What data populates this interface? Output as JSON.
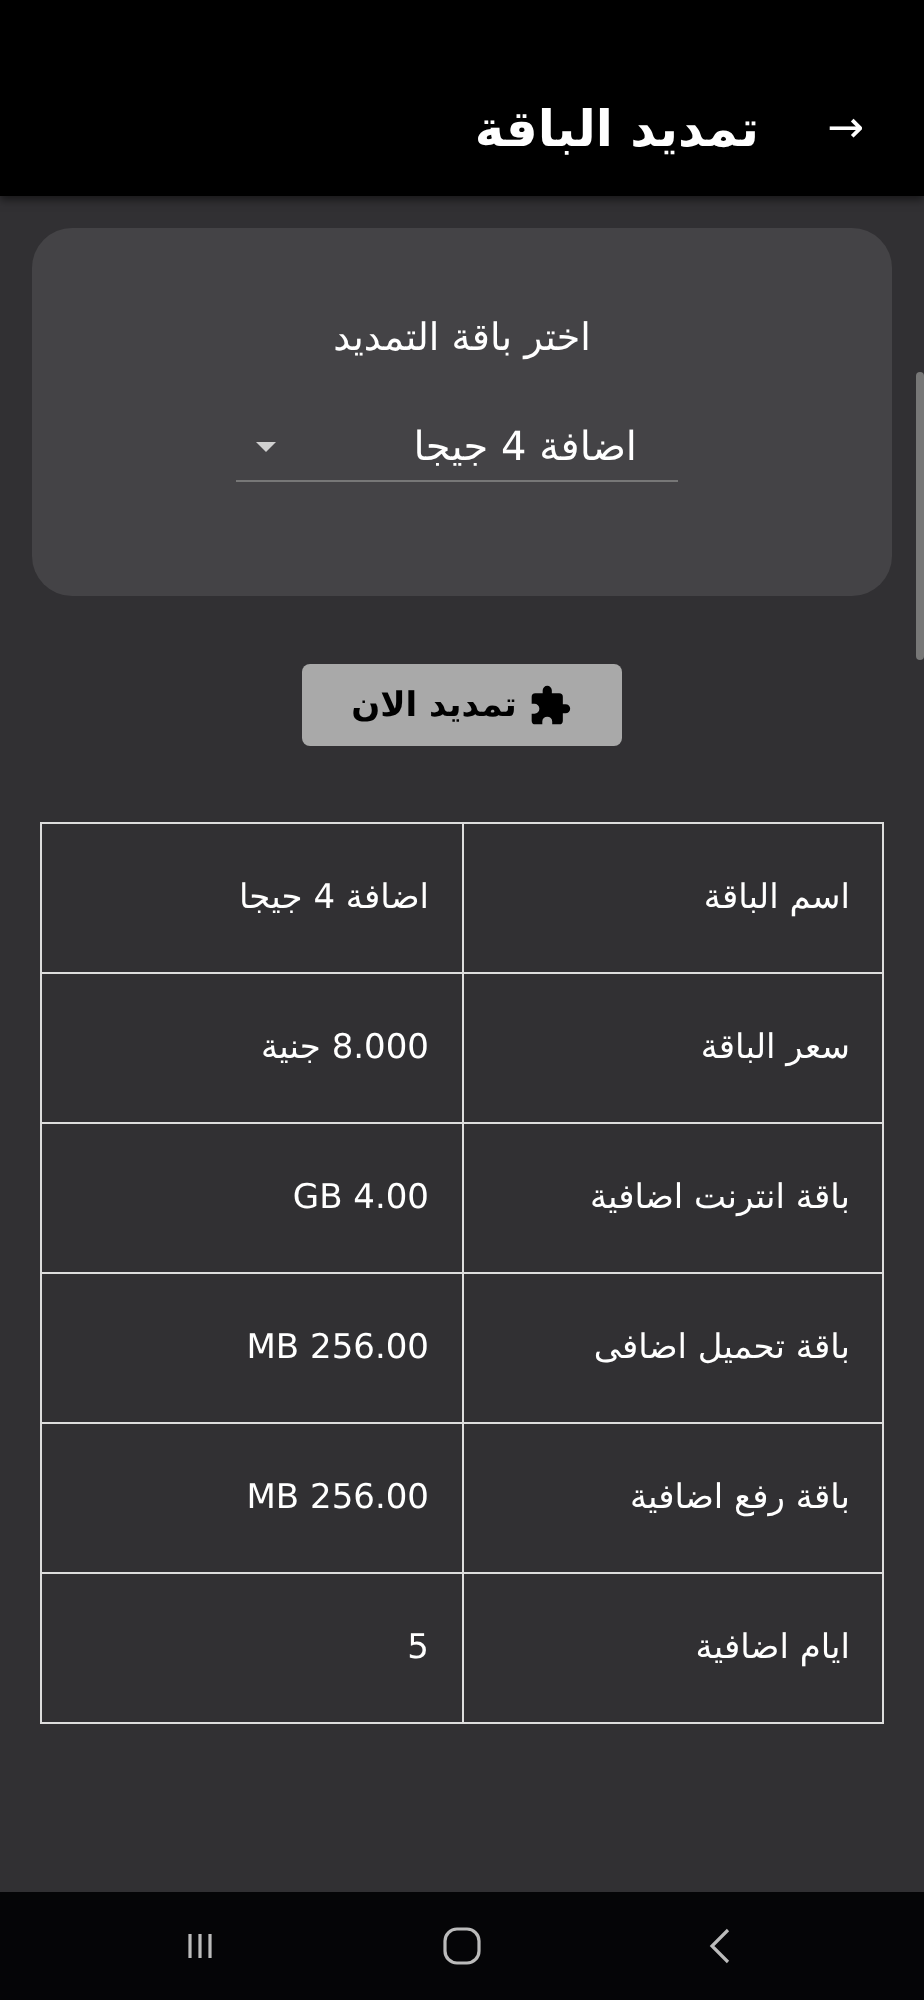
{
  "app_bar": {
    "title": "تمديد الباقة",
    "back": "→"
  },
  "card": {
    "label": "اختر باقة التمديد",
    "dropdown": {
      "value": "اضافة 4 جيجا"
    }
  },
  "renew_button": {
    "label": "تمديد الان"
  },
  "details": [
    {
      "label": "اسم الباقة",
      "value": "اضافة 4 جيجا"
    },
    {
      "label": "سعر الباقة",
      "value": "8.000 جنية"
    },
    {
      "label": "باقة انترنت اضافية",
      "value": "4.00 GB"
    },
    {
      "label": "باقة تحميل اضافى",
      "value": "256.00 MB"
    },
    {
      "label": "باقة رفع اضافية",
      "value": "256.00 MB"
    },
    {
      "label": "ايام اضافية",
      "value": "5"
    }
  ]
}
